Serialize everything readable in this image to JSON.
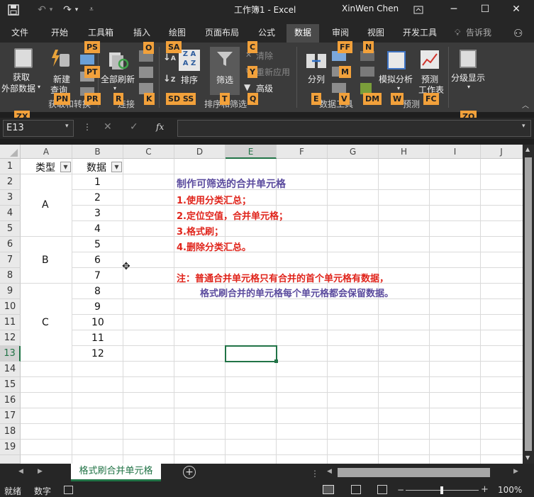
{
  "titlebar": {
    "title": "工作簿1  -  Excel",
    "user": "XinWen Chen"
  },
  "tabs": [
    "文件",
    "开始",
    "工具箱",
    "插入",
    "绘图",
    "页面布局",
    "公式",
    "数据",
    "审阅",
    "视图",
    "开发工具",
    "告诉我"
  ],
  "active_tab": "数据",
  "ribbon": {
    "get_external": "获取\n外部数据",
    "get_external_l1": "获取",
    "get_external_l2": "外部数据",
    "new_query_l1": "新建",
    "new_query_l2": "查询",
    "refresh_all": "全部刷新",
    "sort": "排序",
    "filter": "筛选",
    "clear": "清除",
    "reapply": "重新应用",
    "advanced": "高级",
    "split": "分列",
    "what_if": "模拟分析",
    "forecast_l1": "预测",
    "forecast_l2": "工作表",
    "outline": "分级显示",
    "group_get_transform": "获取和转换",
    "group_connections": "连接",
    "group_sort_filter": "排序和筛选",
    "group_data_tools": "数据工具",
    "group_forecast": "预测"
  },
  "keytips": {
    "ps": "PS",
    "pt": "PT",
    "pn": "PN",
    "pr": "PR",
    "r": "R",
    "o": "O",
    "sa": "SA",
    "k": "K",
    "sd_ss": "SD  SS",
    "t": "T",
    "c": "C",
    "y": "Y",
    "q": "Q",
    "ff": "FF",
    "n": "N",
    "m": "M",
    "e": "E",
    "v": "V",
    "dm": "DM",
    "w": "W",
    "fc": "FC",
    "zx": "ZX",
    "zo": "ZO"
  },
  "formula_bar": {
    "name_box": "E13",
    "fx": "fx"
  },
  "columns": [
    "A",
    "B",
    "C",
    "D",
    "E",
    "F",
    "G",
    "H",
    "I",
    "J"
  ],
  "rows": [
    "1",
    "2",
    "3",
    "4",
    "5",
    "6",
    "7",
    "8",
    "9",
    "10",
    "11",
    "12",
    "13",
    "14",
    "15",
    "16",
    "17",
    "18",
    "19"
  ],
  "cells": {
    "a1": "类型",
    "b1": "数据",
    "merged_a": "A",
    "merged_b": "B",
    "merged_c": "C",
    "b_values": [
      "1",
      "2",
      "3",
      "4",
      "5",
      "6",
      "7",
      "8",
      "9",
      "10",
      "11",
      "12"
    ]
  },
  "notes": {
    "title": "制作可筛选的合并单元格",
    "step1": "1.使用分类汇总；",
    "step2": "2.定位空值，合并单元格；",
    "step3": "3.格式刷；",
    "step4": "4.删除分类汇总。",
    "remark1": "注：普通合并单元格只有合并的首个单元格有数据，",
    "remark2": "格式刷合并的单元格每个单元格都会保留数据。"
  },
  "sheet_tab": "格式刷合并单元格",
  "status": {
    "ready": "就绪",
    "numlock": "数字",
    "zoom": "100%"
  },
  "colors": {
    "title_purple": "#5b4b9e",
    "step_red": "#e0241b",
    "keytip": "#f2a13b",
    "selection": "#217346"
  }
}
